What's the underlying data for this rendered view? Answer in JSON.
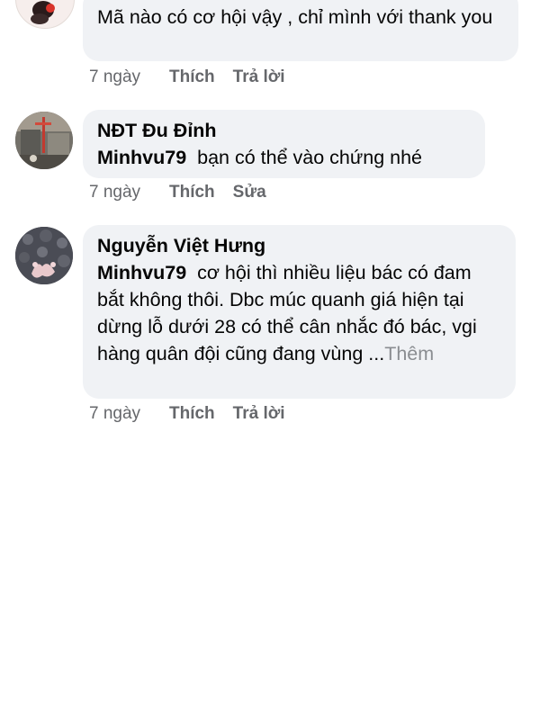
{
  "comments": [
    {
      "author": "",
      "mention": "",
      "text": "Mã nào có cơ hội vậy , chỉ mình với thank you",
      "time": "7 ngày",
      "like_label": "Thích",
      "second_action": "Trả lời",
      "more_label": "",
      "avatar_icon": "user-avatar-cartoon"
    },
    {
      "author": "NĐT Đu Đỉnh",
      "mention": "Minhvu79",
      "text": "bạn có thể vào chứng nhé",
      "time": "7 ngày",
      "like_label": "Thích",
      "second_action": "Sửa",
      "more_label": "",
      "avatar_icon": "user-avatar-photo"
    },
    {
      "author": "Nguyễn Việt Hưng",
      "mention": "Minhvu79",
      "text": "cơ hội thì nhiều liệu bác có đam bắt không thôi. Dbc múc quanh giá hiện tại dừng lỗ dưới 28 có thể cân nhắc đó bác, vgi hàng quân đội cũng đang vùng ...",
      "time": "7 ngày",
      "like_label": "Thích",
      "second_action": "Trả lời",
      "more_label": "Thêm",
      "avatar_icon": "user-avatar-photo"
    }
  ]
}
